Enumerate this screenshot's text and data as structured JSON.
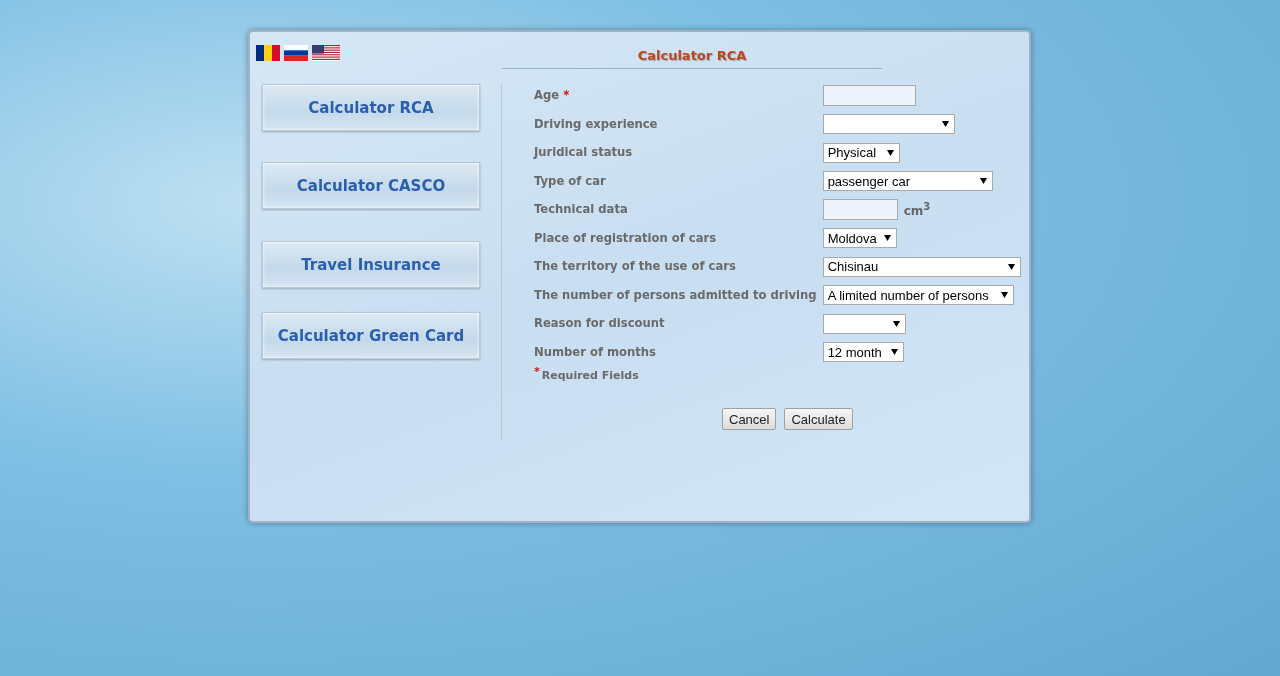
{
  "languages": [
    {
      "kind": "ro"
    },
    {
      "kind": "ru"
    },
    {
      "kind": "us"
    }
  ],
  "title": "Calculator RCA",
  "nav": [
    {
      "label": "Calculator RCA"
    },
    {
      "label": "Calculator CASCO"
    },
    {
      "label": "Travel Insurance"
    },
    {
      "label": "Calculator Green Card"
    }
  ],
  "form": {
    "fields": [
      {
        "label": "Age",
        "required_mark": "*",
        "kind": "text"
      },
      {
        "label": "Driving experience",
        "kind": "select"
      },
      {
        "label": "Juridical status",
        "kind": "select",
        "value": "Physical"
      },
      {
        "label": "Type of car",
        "kind": "select",
        "value": "passenger car"
      },
      {
        "label": "Technical data",
        "kind": "text",
        "unit": "cm$^{3}$"
      },
      {
        "label": "Place of registration of cars",
        "kind": "select",
        "value": "Moldova"
      },
      {
        "label": "The territory of the use of cars",
        "kind": "select",
        "value": "Chisinau"
      },
      {
        "label": "The number of persons admitted to driving",
        "kind": "select",
        "value": "A limited number of persons"
      },
      {
        "label": "Reason for discount",
        "kind": "select"
      },
      {
        "label": "Number of months",
        "kind": "select",
        "value": "12 month"
      }
    ],
    "required_note": {
      "mark": "*",
      "text": "Required Fields"
    },
    "buttons": [
      "Cancel",
      "Calculate"
    ]
  }
}
